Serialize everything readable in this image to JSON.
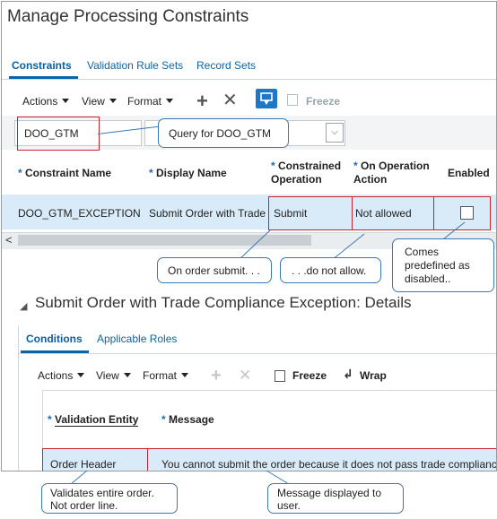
{
  "page": {
    "title": "Manage Processing Constraints"
  },
  "top_tabs": [
    "Constraints",
    "Validation Rule Sets",
    "Record Sets"
  ],
  "toolbar": {
    "actions": "Actions",
    "view": "View",
    "format": "Format",
    "freeze": "Freeze"
  },
  "filter": {
    "constraint_name_value": "DOO_GTM"
  },
  "table": {
    "headers": {
      "constraint_name": "Constraint Name",
      "display_name": "Display Name",
      "constrained_operation_1": "Constrained",
      "constrained_operation_2": "Operation",
      "on_operation_action_1": "On Operation",
      "on_operation_action_2": "Action",
      "enabled": "Enabled"
    },
    "row": {
      "constraint_name": "DOO_GTM_EXCEPTION",
      "display_name": "Submit Order with Trade",
      "constrained_operation": "Submit",
      "on_operation_action": "Not allowed",
      "enabled": false
    }
  },
  "callouts": {
    "query": "Query for DOO_GTM",
    "on_order_submit": "On order  submit. . .",
    "do_not_allow": ". . .do not allow.",
    "comes_predefined_1": "Comes",
    "comes_predefined_2": "predefined  as",
    "comes_predefined_3": "disabled..",
    "validates_1": "Validates entire order.",
    "validates_2": "Not order line.",
    "message_displayed_1": "Message displayed to",
    "message_displayed_2": "user."
  },
  "details": {
    "title": "Submit Order with Trade Compliance Exception: Details",
    "tabs": [
      "Conditions",
      "Applicable Roles"
    ],
    "toolbar": {
      "actions": "Actions",
      "view": "View",
      "format": "Format",
      "freeze": "Freeze",
      "wrap": "Wrap"
    },
    "headers": {
      "validation_entity": "Validation Entity",
      "message": "Message"
    },
    "row": {
      "validation_entity": "Order Header",
      "message": "You cannot submit the order because it does not pass trade compliance"
    }
  }
}
